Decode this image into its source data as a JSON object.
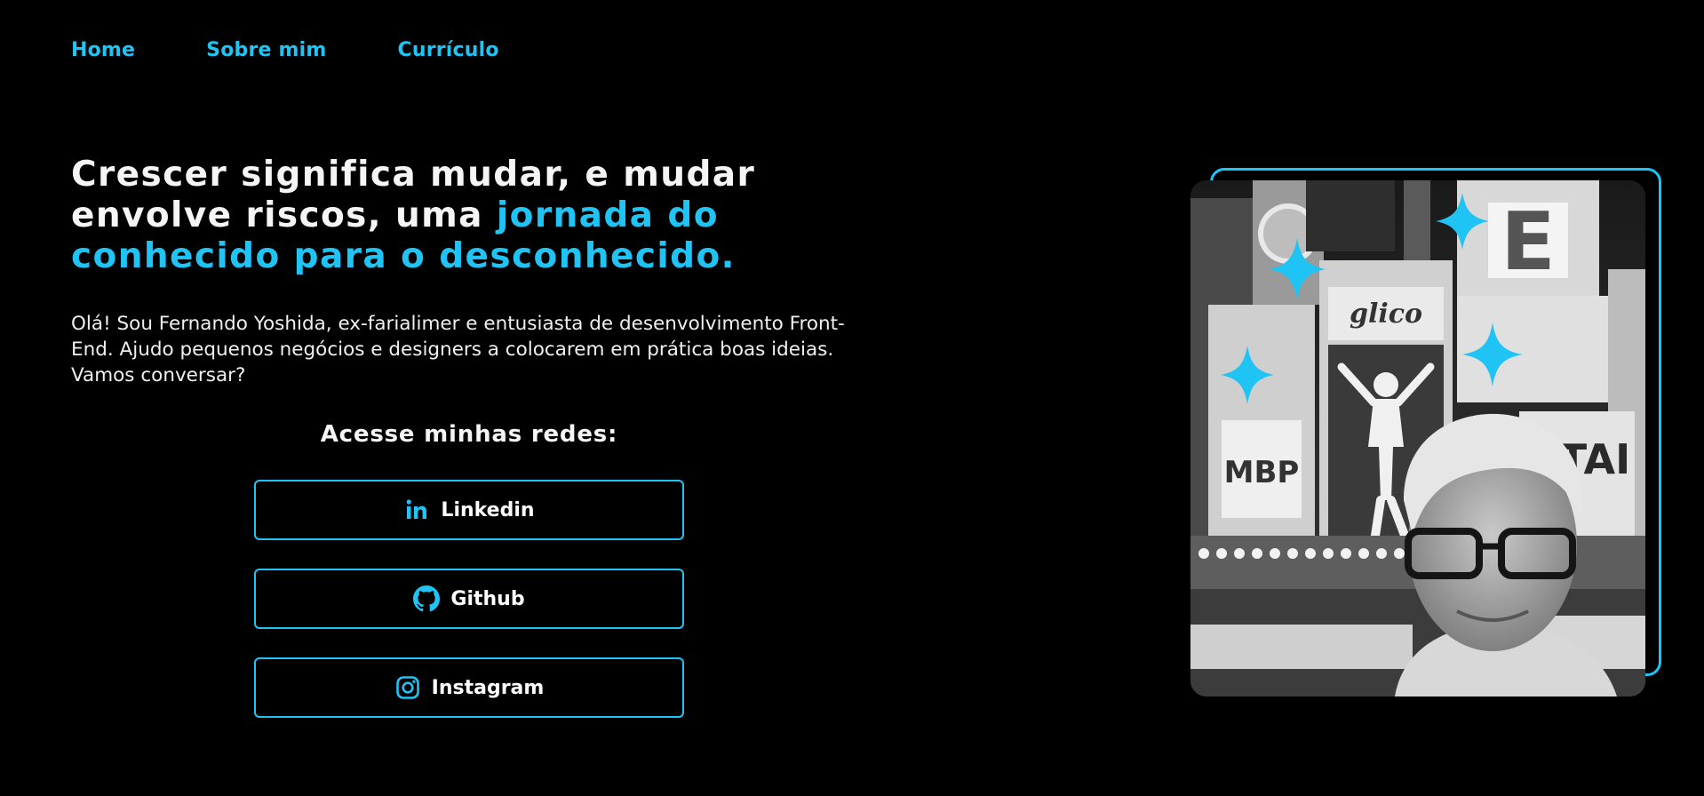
{
  "nav": {
    "items": [
      "Home",
      "Sobre mim",
      "Currículo"
    ]
  },
  "hero": {
    "headline_part1": "Crescer significa mudar, e mudar envolve riscos, uma ",
    "headline_accent": "jornada do conhecido para o desconhecido.",
    "intro": "Olá! Sou Fernando Yoshida, ex-farialimer e entusiasta de desenvolvimento Front-End. Ajudo pequenos negócios e designers a colocarem em prática boas ideias. Vamos conversar?"
  },
  "social": {
    "title": "Acesse minhas redes:",
    "buttons": [
      {
        "label": "Linkedin",
        "icon": "linkedin-icon"
      },
      {
        "label": "Github",
        "icon": "github-icon"
      },
      {
        "label": "Instagram",
        "icon": "instagram-icon"
      }
    ]
  },
  "photo": {
    "alt": "",
    "signs": [
      "glico",
      "MBP",
      "E",
      "TAI"
    ]
  },
  "colors": {
    "accent": "#1fc4f5",
    "background": "#000000",
    "text": "#ffffff"
  }
}
